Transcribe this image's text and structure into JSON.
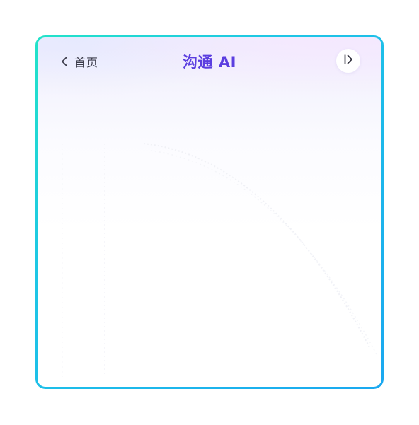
{
  "header": {
    "back_label": "首页",
    "title": "沟通 AI"
  },
  "icons": {
    "back": "chevron-left-icon",
    "collapse": "collapse-right-icon"
  },
  "colors": {
    "title": "#5b3ee0",
    "border_start": "#22e3c8",
    "border_end": "#1aa8f0",
    "text": "#3b3b4a"
  }
}
